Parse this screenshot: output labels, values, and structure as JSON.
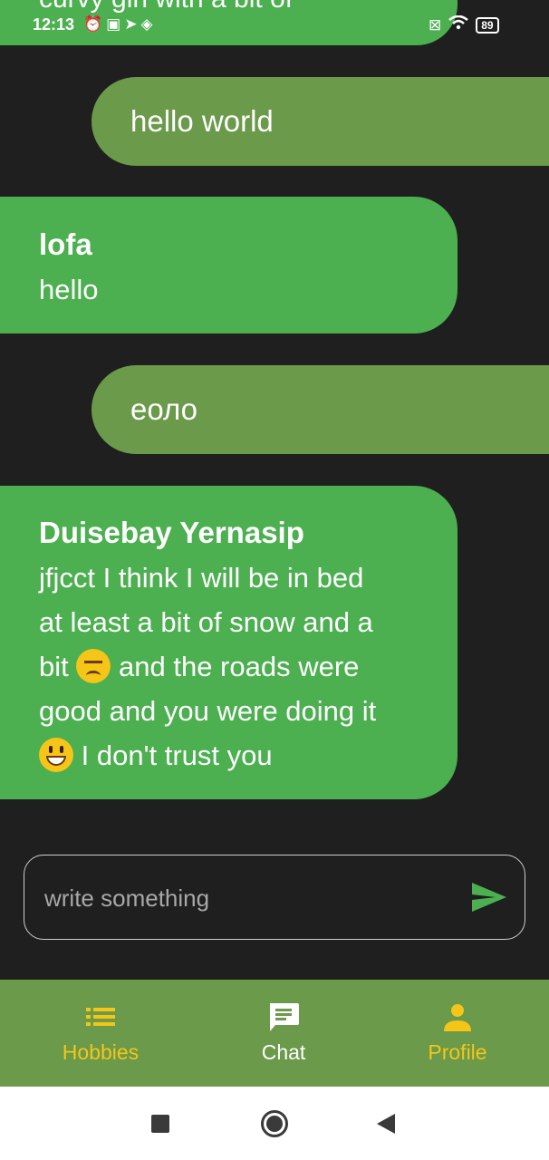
{
  "status_bar": {
    "time": "12:13",
    "left_icons": [
      "alarm-off-icon",
      "app-notification-icon",
      "telegram-icon",
      "layers-icon"
    ],
    "right_icons": [
      "sim-off-icon",
      "wifi-icon"
    ],
    "battery": "89"
  },
  "messages": [
    {
      "direction": "incoming",
      "sender": "",
      "text": "curvy girl with a bit of",
      "cut_off": true
    },
    {
      "direction": "outgoing",
      "text": "hello world"
    },
    {
      "direction": "incoming",
      "sender": "lofa",
      "text": "hello"
    },
    {
      "direction": "outgoing",
      "text": "еоло"
    },
    {
      "direction": "incoming",
      "sender": "Duisebay Yernasip",
      "lines": [
        "jfjcct I think I will be in bed",
        "at least a bit of snow and a",
        "bit",
        "and the roads were",
        "good and you were doing it",
        "I don't trust you"
      ],
      "emojis": [
        "disappointed-face",
        "grinning-face"
      ]
    }
  ],
  "composer": {
    "placeholder": "write something",
    "value": "",
    "send_icon": "send-icon"
  },
  "bottom_nav": {
    "items": [
      {
        "label": "Hobbies",
        "icon": "list-icon",
        "active": false
      },
      {
        "label": "Chat",
        "icon": "chat-icon",
        "active": true
      },
      {
        "label": "Profile",
        "icon": "person-icon",
        "active": false
      }
    ]
  },
  "colors": {
    "background": "#1f1f1f",
    "incoming_bubble": "#4caf50",
    "outgoing_bubble": "#6a9a4a",
    "nav_background": "#6a9a4a",
    "nav_inactive": "#f5c518",
    "nav_active": "#ffffff",
    "send_icon": "#4caf50"
  },
  "system_nav": {
    "buttons": [
      "recents-square-icon",
      "home-circle-icon",
      "back-triangle-icon"
    ]
  }
}
